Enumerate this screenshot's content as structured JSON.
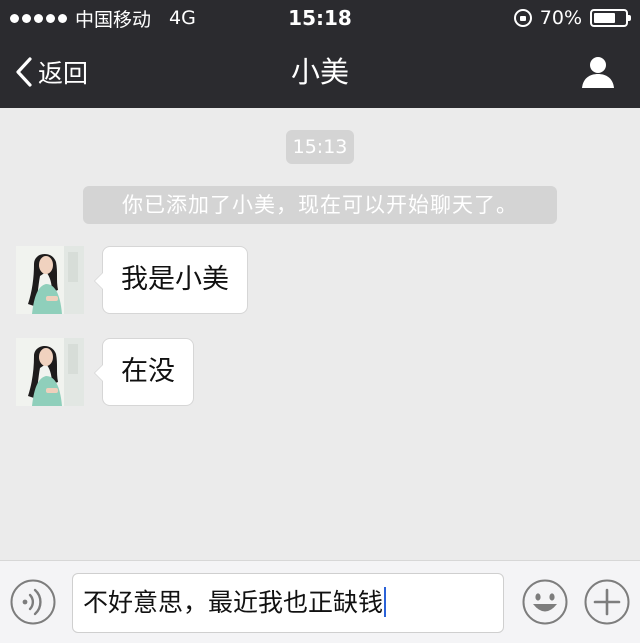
{
  "status_bar": {
    "carrier": "中国移动",
    "network": "4G",
    "time": "15:18",
    "battery_text": "70%",
    "battery_level": 0.7
  },
  "nav": {
    "back_label": "返回",
    "title": "小美"
  },
  "chat": {
    "timestamp": "15:13",
    "system_notice": "你已添加了小美，现在可以开始聊天了。",
    "messages": [
      {
        "sender": "小美",
        "text": "我是小美"
      },
      {
        "sender": "小美",
        "text": "在没"
      }
    ]
  },
  "input_bar": {
    "draft": "不好意思，最近我也正缺钱"
  },
  "icons": {
    "back": "chevron-left-icon",
    "profile": "person-icon",
    "voice": "voice-icon",
    "emoji": "smiley-icon",
    "more": "plus-icon"
  },
  "colors": {
    "header_bg": "#2b2b2f",
    "chat_bg": "#ebebeb",
    "pill_bg": "#d4d4d4",
    "bubble_bg": "#ffffff",
    "caret": "#2a62d8"
  }
}
